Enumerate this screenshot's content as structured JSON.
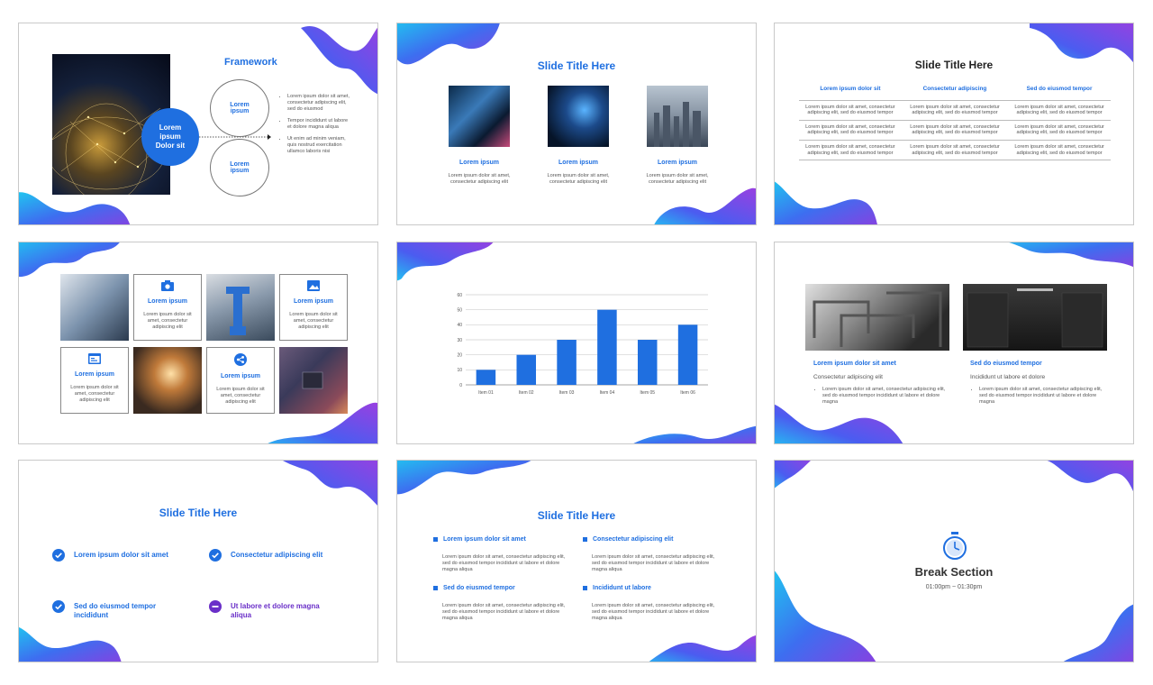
{
  "colors": {
    "accent": "#1f6fe0",
    "purple": "#7b3fe4",
    "cyan": "#1fc8f0"
  },
  "slide1": {
    "title": "Framework",
    "center_circle": "Lorem ipsum Dolor sit",
    "circle_top": "Lorem ipsum",
    "circle_bottom": "Lorem ipsum",
    "bullets": [
      "Lorem ipsum dolor sit amet, consectetur adipiscing elit, sed do eiusmod",
      "Tempor incididunt ut labore et dolore magna aliqua",
      "Ut enim ad minim veniam, quis nostrud exercitation ullamco laboris nisi"
    ]
  },
  "slide2": {
    "title": "Slide Title Here",
    "items": [
      {
        "label": "Lorem ipsum",
        "text": "Lorem ipsum dolor sit amet, consectetur adipiscing elit"
      },
      {
        "label": "Lorem ipsum",
        "text": "Lorem ipsum dolor sit amet, consectetur adipiscing elit"
      },
      {
        "label": "Lorem ipsum",
        "text": "Lorem ipsum dolor sit amet, consectetur adipiscing elit"
      }
    ]
  },
  "slide3": {
    "title": "Slide Title Here",
    "headers": [
      "Lorem ipsum dolor sit",
      "Consectetur adipiscing",
      "Sed do eiusmod tempor"
    ],
    "cell": "Lorem ipsum dolor sit amet, consectetur adipiscing elit, sed do eiusmod tempor"
  },
  "slide4": {
    "cards": [
      {
        "label": "Lorem ipsum",
        "text": "Lorem ipsum dolor sit amet, consectetur adipiscing elit",
        "icon": "camera-icon"
      },
      {
        "label": "Lorem ipsum",
        "text": "Lorem ipsum dolor sit amet, consectetur adipiscing elit",
        "icon": "image-icon"
      },
      {
        "label": "Lorem ipsum",
        "text": "Lorem ipsum dolor sit amet, consectetur adipiscing elit",
        "icon": "browser-icon"
      },
      {
        "label": "Lorem ipsum",
        "text": "Lorem ipsum dolor sit amet, consectetur adipiscing elit",
        "icon": "share-icon"
      }
    ]
  },
  "chart_data": {
    "type": "bar",
    "categories": [
      "Item 01",
      "Item 02",
      "Item 03",
      "Item 04",
      "Item 05",
      "Item 06"
    ],
    "values": [
      10,
      20,
      30,
      50,
      30,
      40
    ],
    "ylim": [
      0,
      60
    ],
    "yticks": [
      0,
      10,
      20,
      30,
      40,
      50,
      60
    ],
    "grid": true,
    "color": "#1f6fe0"
  },
  "slide6": {
    "left": {
      "heading": "Lorem ipsum dolor sit amet",
      "sub": "Consectetur adipiscing elit",
      "bullet": "Lorem ipsum dolor sit amet, consectetur adipiscing elit, sed do eiusmod tempor incididunt ut labore et dolore magna"
    },
    "right": {
      "heading": "Sed do eiusmod tempor",
      "sub": "Incididunt ut labore et dolore",
      "bullet": "Lorem ipsum dolor sit amet, consectetur adipiscing elit, sed do eiusmod tempor incididunt ut labore et dolore magna"
    }
  },
  "slide7": {
    "title": "Slide Title Here",
    "items": [
      {
        "text": "Lorem ipsum dolor sit amet",
        "status": "check"
      },
      {
        "text": "Consectetur adipiscing elit",
        "status": "check"
      },
      {
        "text": "Sed do eiusmod tempor incididunt",
        "status": "check"
      },
      {
        "text": "Ut labore et dolore magna aliqua",
        "status": "minus"
      }
    ]
  },
  "slide8": {
    "title": "Slide Title Here",
    "blocks": [
      {
        "heading": "Lorem ipsum dolor sit amet",
        "text": "Lorem ipsum dolor sit amet, consectetur adipiscing elit, sed do eiusmod tempor incididunt ut labore et dolore magna aliqua"
      },
      {
        "heading": "Consectetur adipiscing elit",
        "text": "Lorem ipsum dolor sit amet, consectetur adipiscing elit, sed do eiusmod tempor incididunt ut labore et dolore magna aliqua"
      },
      {
        "heading": "Sed do eiusmod tempor",
        "text": "Lorem ipsum dolor sit amet, consectetur adipiscing elit, sed do eiusmod tempor incididunt ut labore et dolore magna aliqua"
      },
      {
        "heading": "Incididunt ut labore",
        "text": "Lorem ipsum dolor sit amet, consectetur adipiscing elit, sed do eiusmod tempor incididunt ut labore et dolore magna aliqua"
      }
    ]
  },
  "slide9": {
    "title": "Break Section",
    "time": "01:00pm ~ 01:30pm",
    "icon": "stopwatch-icon"
  }
}
